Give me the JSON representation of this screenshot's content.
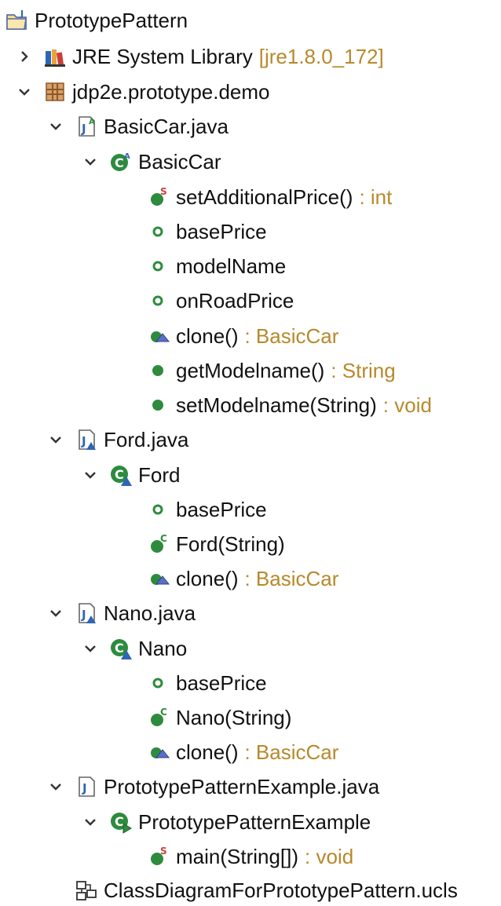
{
  "colors": {
    "decoration": "#b7892b",
    "member_green": "#2e8b3e",
    "class_blue": "#2f66b3"
  },
  "tree": {
    "project": {
      "label": "PrototypePattern",
      "icon": "project-folder-icon"
    },
    "jre": {
      "label": "JRE System Library",
      "decoration": "[jre1.8.0_172]",
      "icon": "library-icon",
      "expanded": false
    },
    "package": {
      "label": "jdp2e.prototype.demo",
      "icon": "package-icon",
      "expanded": true
    },
    "basiccar_file": {
      "label": "BasicCar.java",
      "icon": "java-file-abstract-icon",
      "expanded": true,
      "class": {
        "label": "BasicCar",
        "icon": "abstract-class-icon",
        "members": [
          {
            "name": "setAdditionalPrice()",
            "decoration": ": int",
            "icon": "static-method-icon"
          },
          {
            "name": "basePrice",
            "decoration": "",
            "icon": "field-icon"
          },
          {
            "name": "modelName",
            "decoration": "",
            "icon": "field-icon"
          },
          {
            "name": "onRoadPrice",
            "decoration": "",
            "icon": "field-icon"
          },
          {
            "name": "clone()",
            "decoration": ": BasicCar",
            "icon": "protected-method-icon"
          },
          {
            "name": "getModelname()",
            "decoration": ": String",
            "icon": "public-method-icon"
          },
          {
            "name": "setModelname(String)",
            "decoration": ": void",
            "icon": "public-method-icon"
          }
        ]
      }
    },
    "ford_file": {
      "label": "Ford.java",
      "icon": "java-file-icon",
      "expanded": true,
      "class": {
        "label": "Ford",
        "icon": "class-icon",
        "members": [
          {
            "name": "basePrice",
            "decoration": "",
            "icon": "field-icon"
          },
          {
            "name": "Ford(String)",
            "decoration": "",
            "icon": "constructor-icon"
          },
          {
            "name": "clone()",
            "decoration": ": BasicCar",
            "icon": "protected-method-icon"
          }
        ]
      }
    },
    "nano_file": {
      "label": "Nano.java",
      "icon": "java-file-icon",
      "expanded": true,
      "class": {
        "label": "Nano",
        "icon": "class-icon",
        "members": [
          {
            "name": "basePrice",
            "decoration": "",
            "icon": "field-icon"
          },
          {
            "name": "Nano(String)",
            "decoration": "",
            "icon": "constructor-icon"
          },
          {
            "name": "clone()",
            "decoration": ": BasicCar",
            "icon": "protected-method-icon"
          }
        ]
      }
    },
    "example_file": {
      "label": "PrototypePatternExample.java",
      "icon": "java-file-plain-icon",
      "expanded": true,
      "class": {
        "label": "PrototypePatternExample",
        "icon": "runnable-class-icon",
        "members": [
          {
            "name": "main(String[])",
            "decoration": ": void",
            "icon": "static-method-icon"
          }
        ]
      }
    },
    "ucls": {
      "label": "ClassDiagramForPrototypePattern.ucls",
      "icon": "class-diagram-icon"
    }
  }
}
